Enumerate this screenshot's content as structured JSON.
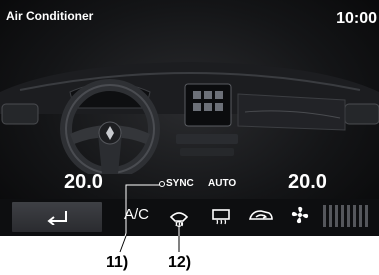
{
  "header": {
    "title": "Air Conditioner",
    "clock": "10:00"
  },
  "climate": {
    "left_temp": "20.0",
    "right_temp": "20.0",
    "sync_label": "SYNC",
    "auto_label": "AUTO"
  },
  "controls": {
    "ac_label": "A/C",
    "fan_level": 0,
    "icons": [
      "back-arrow-icon",
      "front-defrost-icon",
      "rear-defrost-icon",
      "recirculation-icon",
      "fan-icon"
    ]
  },
  "callouts": {
    "label_11": "11)",
    "label_12": "12)"
  },
  "colors": {
    "screen_bg": "#141517",
    "text": "#ffffff",
    "button_bg": "#34363a",
    "level_off": "#55575c"
  }
}
